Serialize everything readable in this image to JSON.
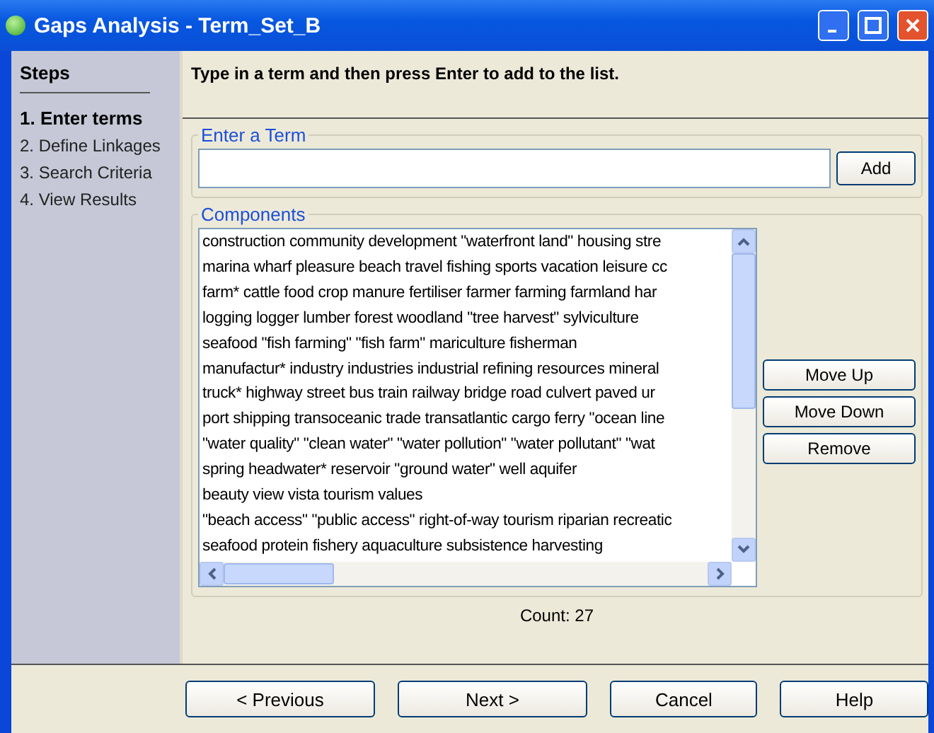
{
  "window": {
    "title": "Gaps Analysis - Term_Set_B"
  },
  "sidebar": {
    "title": "Steps",
    "items": [
      {
        "label": "1. Enter terms",
        "selected": true
      },
      {
        "label": "2. Define Linkages",
        "selected": false
      },
      {
        "label": "3. Search Criteria",
        "selected": false
      },
      {
        "label": "4. View Results",
        "selected": false
      }
    ]
  },
  "instruction": "Type in a term and then press Enter to add to the list.",
  "enter_term": {
    "legend": "Enter a Term",
    "add_button": "Add"
  },
  "components": {
    "legend": "Components",
    "items": [
      "construction community development \"waterfront land\" housing stre",
      "marina wharf pleasure beach travel fishing sports vacation leisure cc",
      "farm* cattle food crop manure fertiliser farmer farming farmland har",
      "logging logger lumber forest woodland \"tree harvest\" sylviculture",
      "seafood \"fish farming\" \"fish farm\" mariculture fisherman",
      "manufactur* industry industries industrial refining resources mineral",
      "truck* highway street bus train railway bridge road culvert paved ur",
      "port shipping transoceanic trade transatlantic cargo ferry \"ocean line",
      "\"water quality\" \"clean water\" \"water pollution\" \"water pollutant\" \"wat",
      "spring headwater* reservoir \"ground water\" well aquifer",
      "beauty view vista tourism values",
      "\"beach access\" \"public access\" right-of-way tourism riparian recreatic",
      "seafood protein fishery aquaculture subsistence harvesting"
    ],
    "buttons": [
      "Move Up",
      "Move Down",
      "Remove"
    ],
    "count": "Count: 27"
  },
  "footer_buttons": [
    "< Previous",
    "Next >",
    "Cancel",
    "Help"
  ]
}
